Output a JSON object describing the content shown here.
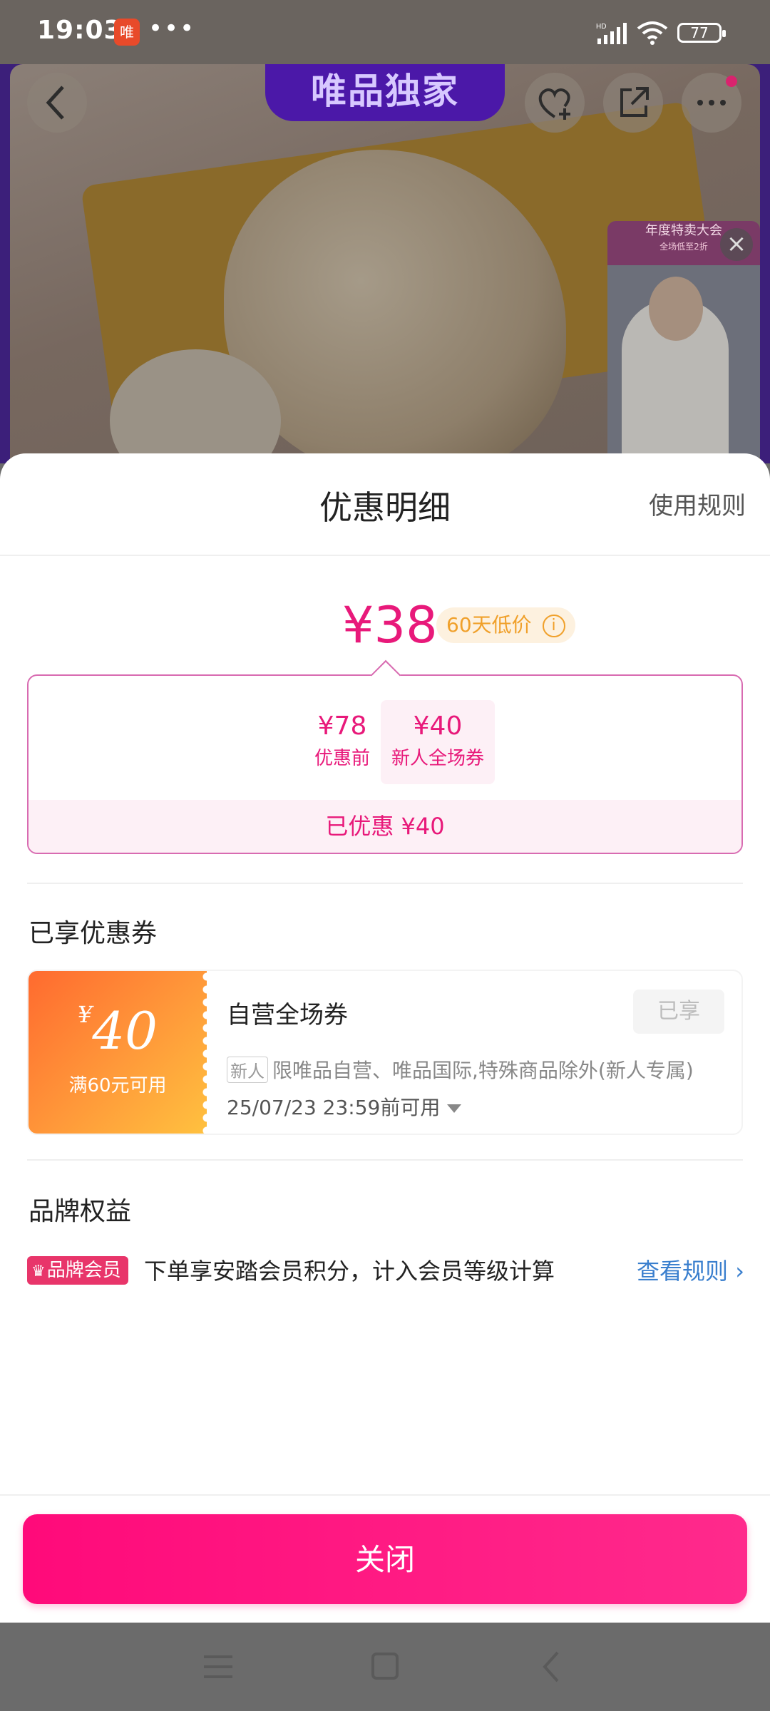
{
  "status_bar": {
    "time": "19:03",
    "app_badge": "唯",
    "more": "•••",
    "battery": "77",
    "network": "HD"
  },
  "product": {
    "exclusive_label": "唯品独家",
    "live": {
      "banner_title": "年度特卖大会",
      "banner_sub": "全场低至2折"
    }
  },
  "sheet": {
    "title": "优惠明细",
    "rules_link": "使用规则",
    "final_price": "¥38",
    "price_tag": "60天低价",
    "calc": {
      "before_value": "¥78",
      "before_label": "优惠前",
      "minus": "-",
      "coupon_value": "¥40",
      "coupon_label": "新人全场券",
      "saved": "已优惠 ¥40"
    },
    "coupons_title": "已享优惠券",
    "coupon": {
      "amount_prefix": "¥",
      "amount": "40",
      "condition": "满60元可用",
      "name": "自营全场券",
      "status": "已享",
      "tag": "新人",
      "description": "限唯品自营、唯品国际,特殊商品除外(新人专属)",
      "expiry": "25/07/23 23:59前可用"
    },
    "brand_title": "品牌权益",
    "benefit": {
      "badge": "品牌会员",
      "text": "下单享安踏会员积分，计入会员等级计算",
      "link": "查看规则 ›"
    },
    "close_button": "关闭"
  },
  "colors": {
    "accent": "#e8197a",
    "link": "#3a7fce",
    "coupon_orange": "#ff6a2f",
    "exclusive_purple": "#4b18a8"
  }
}
